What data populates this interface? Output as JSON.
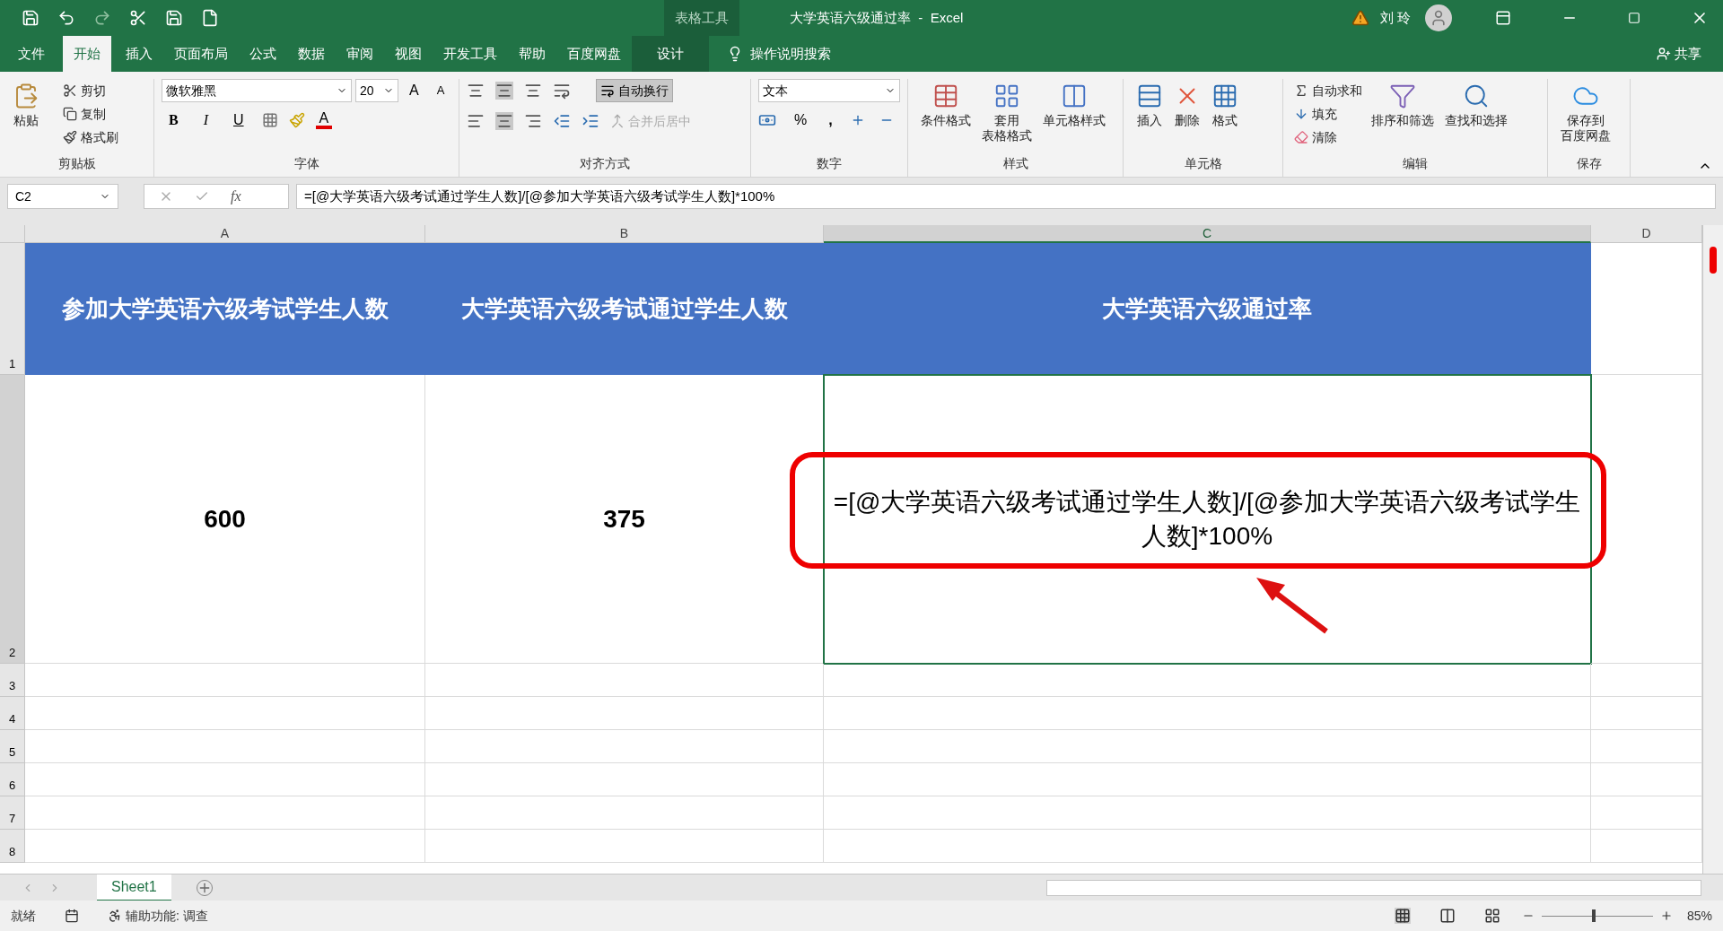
{
  "title_bar": {
    "context_label": "表格工具",
    "title": "大学英语六级通过率  -  Excel",
    "user": "刘 玲",
    "share": "共享"
  },
  "tabs": [
    {
      "label": "文件",
      "selected": false,
      "kind": "file"
    },
    {
      "label": "开始",
      "selected": true,
      "kind": "normal"
    },
    {
      "label": "插入",
      "selected": false,
      "kind": "normal"
    },
    {
      "label": "页面布局",
      "selected": false,
      "kind": "normal"
    },
    {
      "label": "公式",
      "selected": false,
      "kind": "normal"
    },
    {
      "label": "数据",
      "selected": false,
      "kind": "normal"
    },
    {
      "label": "审阅",
      "selected": false,
      "kind": "normal"
    },
    {
      "label": "视图",
      "selected": false,
      "kind": "normal"
    },
    {
      "label": "开发工具",
      "selected": false,
      "kind": "normal"
    },
    {
      "label": "帮助",
      "selected": false,
      "kind": "normal"
    },
    {
      "label": "百度网盘",
      "selected": false,
      "kind": "normal"
    },
    {
      "label": "设计",
      "selected": false,
      "kind": "context"
    }
  ],
  "tell_me": "操作说明搜索",
  "ribbon": {
    "clipboard": {
      "title": "剪贴板",
      "paste": "粘贴",
      "items": [
        "剪切",
        "复制",
        "格式刷"
      ]
    },
    "font": {
      "title": "字体",
      "font_name": "微软雅黑",
      "font_size": "20",
      "grow": "A",
      "shrink": "A",
      "bold": "B",
      "italic": "I",
      "underline": "U",
      "color_button": "A"
    },
    "alignment": {
      "title": "对齐方式",
      "wrap": {
        "label": "自动换行",
        "on": true
      },
      "merge": {
        "label": "合并后居中",
        "disabled": true
      }
    },
    "number": {
      "title": "数字",
      "format": "文本",
      "percent": "%",
      "comma": ","
    },
    "styles": {
      "title": "样式",
      "items": [
        {
          "lines": [
            "条件格式"
          ]
        },
        {
          "lines": [
            "套用",
            "表格格式"
          ]
        },
        {
          "lines": [
            "单元格样式"
          ]
        }
      ]
    },
    "cells": {
      "title": "单元格",
      "items": [
        "插入",
        "删除",
        "格式"
      ]
    },
    "editing": {
      "title": "编辑",
      "small": [
        "自动求和",
        "填充",
        "清除"
      ],
      "large": [
        "排序和筛选",
        "查找和选择"
      ]
    },
    "save": {
      "title": "保存",
      "lines": [
        "保存到",
        "百度网盘"
      ]
    }
  },
  "formula_bar": {
    "name_box": "C2",
    "fx": "fx",
    "formula": "=[@大学英语六级考试通过学生人数]/[@参加大学英语六级考试学生人数]*100%"
  },
  "columns": [
    {
      "label": "A",
      "selected": false
    },
    {
      "label": "B",
      "selected": false
    },
    {
      "label": "C",
      "selected": true
    },
    {
      "label": "D",
      "selected": false
    }
  ],
  "rows": [
    {
      "label": "1",
      "kind": "header",
      "cells": [
        "参加大学英语六级考试学生人数",
        "大学英语六级考试通过学生人数",
        "大学英语六级通过率"
      ]
    },
    {
      "label": "2",
      "kind": "data",
      "cells": [
        "600",
        "375",
        "=[@大学英语六级考试通过学生人数]/[@参加大学英语六级考试学生人数]*100%"
      ]
    },
    {
      "label": "3",
      "kind": "empty",
      "cells": []
    },
    {
      "label": "4",
      "kind": "empty",
      "cells": []
    },
    {
      "label": "5",
      "kind": "empty",
      "cells": []
    },
    {
      "label": "6",
      "kind": "empty",
      "cells": []
    },
    {
      "label": "7",
      "kind": "empty",
      "cells": []
    },
    {
      "label": "8",
      "kind": "empty",
      "cells": []
    }
  ],
  "sheets": [
    {
      "label": "Sheet1",
      "selected": true
    }
  ],
  "status_bar": {
    "ready": "就绪",
    "accessibility": "辅助功能: 调查",
    "zoom": "85%",
    "zoom_slider": {
      "level": 0.45
    }
  }
}
